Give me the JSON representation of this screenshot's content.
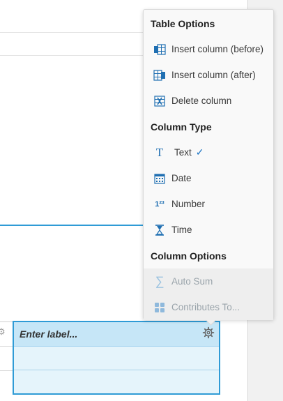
{
  "menu": {
    "table_options_title": "Table Options",
    "column_type_title": "Column Type",
    "column_options_title": "Column Options",
    "items": [
      {
        "label": "Insert column (before)",
        "icon": "insert-column-before-icon"
      },
      {
        "label": "Insert column (after)",
        "icon": "insert-column-after-icon"
      },
      {
        "label": "Delete column",
        "icon": "delete-column-icon"
      }
    ],
    "types": [
      {
        "label": "Text",
        "icon": "text-type-icon",
        "selected": true,
        "glyph": "T"
      },
      {
        "label": "Date",
        "icon": "calendar-icon"
      },
      {
        "label": "Number",
        "icon": "number-icon",
        "glyph": "1²³"
      },
      {
        "label": "Time",
        "icon": "hourglass-icon"
      }
    ],
    "options": [
      {
        "label": "Auto Sum",
        "icon": "sigma-icon",
        "disabled": true
      },
      {
        "label": "Contributes To...",
        "icon": "grid-icon",
        "disabled": true
      }
    ],
    "check_glyph": "✓",
    "sigma_glyph": "∑"
  },
  "column": {
    "label_placeholder": "Enter label..."
  },
  "colors": {
    "accent": "#2f9bd6",
    "icon_blue": "#1f6fb2",
    "header_fill": "#c6e6f7",
    "cell_fill": "#e5f4fb"
  }
}
